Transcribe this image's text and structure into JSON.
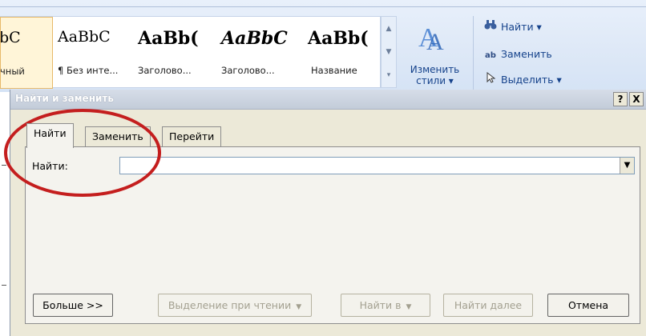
{
  "ribbon": {
    "styles": [
      {
        "preview": "bC",
        "caption": "чный",
        "selected": true
      },
      {
        "preview": "AaBbC",
        "caption": "¶ Без инте...",
        "selected": false
      },
      {
        "preview": "AaBb(",
        "caption": "Заголово...",
        "selected": false
      },
      {
        "preview": "AaBbC",
        "caption": "Заголово...",
        "selected": false
      },
      {
        "preview": "AaBb(",
        "caption": "Название",
        "selected": false
      }
    ],
    "change_styles": {
      "line1": "Изменить",
      "line2": "стили ▾"
    },
    "editing": {
      "find": "Найти ▾",
      "replace": "Заменить",
      "select": "Выделить ▾"
    }
  },
  "dialog": {
    "title": "Найти и заменить",
    "help_button": "?",
    "close_button": "X",
    "tabs": [
      {
        "label": "Найти",
        "active": true
      },
      {
        "label": "Заменить",
        "active": false
      },
      {
        "label": "Перейти",
        "active": false
      }
    ],
    "find_label": "Найти:",
    "find_value": "",
    "buttons": {
      "more": "Больше >>",
      "reading_highlight": "Выделение при чтении",
      "find_in": "Найти в",
      "find_next": "Найти далее",
      "cancel": "Отмена"
    }
  },
  "colors": {
    "annotation_circle": "#c41e1e",
    "ribbon_text": "#15428b",
    "dialog_bg": "#ece9d8"
  }
}
